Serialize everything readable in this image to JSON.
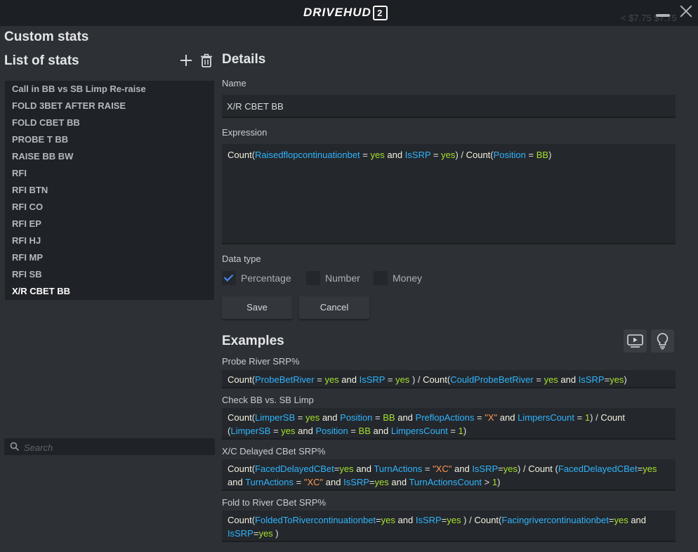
{
  "app": {
    "logo_text": "DRIVEHUD",
    "logo_version": "2",
    "ghost_text": "< $7.75 $7.75"
  },
  "page_title": "Custom stats",
  "list": {
    "title": "List of stats",
    "items": [
      "Call in BB vs SB Limp Re-raise",
      "FOLD 3BET AFTER RAISE",
      "FOLD CBET BB",
      "PROBE T BB",
      "RAISE BB BW",
      "RFI",
      "RFI BTN",
      "RFI CO",
      "RFI EP",
      "RFI HJ",
      "RFI MP",
      "RFI SB",
      "X/R CBET BB"
    ],
    "selected": "X/R CBET BB",
    "search_placeholder": "Search"
  },
  "details": {
    "title": "Details",
    "name_label": "Name",
    "name_value": "X/R CBET BB",
    "expression_label": "Expression",
    "expression": "Count(Raisedflopcontinuationbet = yes and IsSRP = yes) / Count(Position = BB)",
    "data_type_label": "Data type",
    "data_types": [
      {
        "label": "Percentage",
        "checked": true
      },
      {
        "label": "Number",
        "checked": false
      },
      {
        "label": "Money",
        "checked": false
      }
    ],
    "save_label": "Save",
    "cancel_label": "Cancel"
  },
  "examples": {
    "title": "Examples",
    "items": [
      {
        "label": "Probe River SRP%",
        "expression": "Count(ProbeBetRiver = yes and IsSRP = yes ) / Count(CouldProbeBetRiver = yes and IsSRP=yes)"
      },
      {
        "label": "Check BB vs. SB Limp",
        "expression": "Count(LimperSB = yes and Position = BB and PreflopActions = \"X\" and LimpersCount = 1) / Count (LimperSB = yes and Position = BB and LimpersCount = 1)"
      },
      {
        "label": "X/C Delayed CBet SRP%",
        "expression": "Count(FacedDelayedCBet=yes and TurnActions = \"XC\" and IsSRP=yes) / Count (FacedDelayedCBet=yes and TurnActions = \"XC\" and IsSRP=yes and TurnActionsCount > 1)"
      },
      {
        "label": "Fold to River CBet SRP%",
        "expression": "Count(FoldedToRivercontinuationbet=yes and IsSRP=yes ) / Count(Facingrivercontinuationbet=yes and IsSRP=yes )"
      }
    ]
  },
  "colors": {
    "background": "#2d3136",
    "titlebar": "#1c1f23",
    "variable": "#2fb5ff",
    "yes": "#a6e22e",
    "string": "#ff9a55",
    "keyword": "#f3f3e2",
    "checkbox_tick": "#4d8cff"
  }
}
